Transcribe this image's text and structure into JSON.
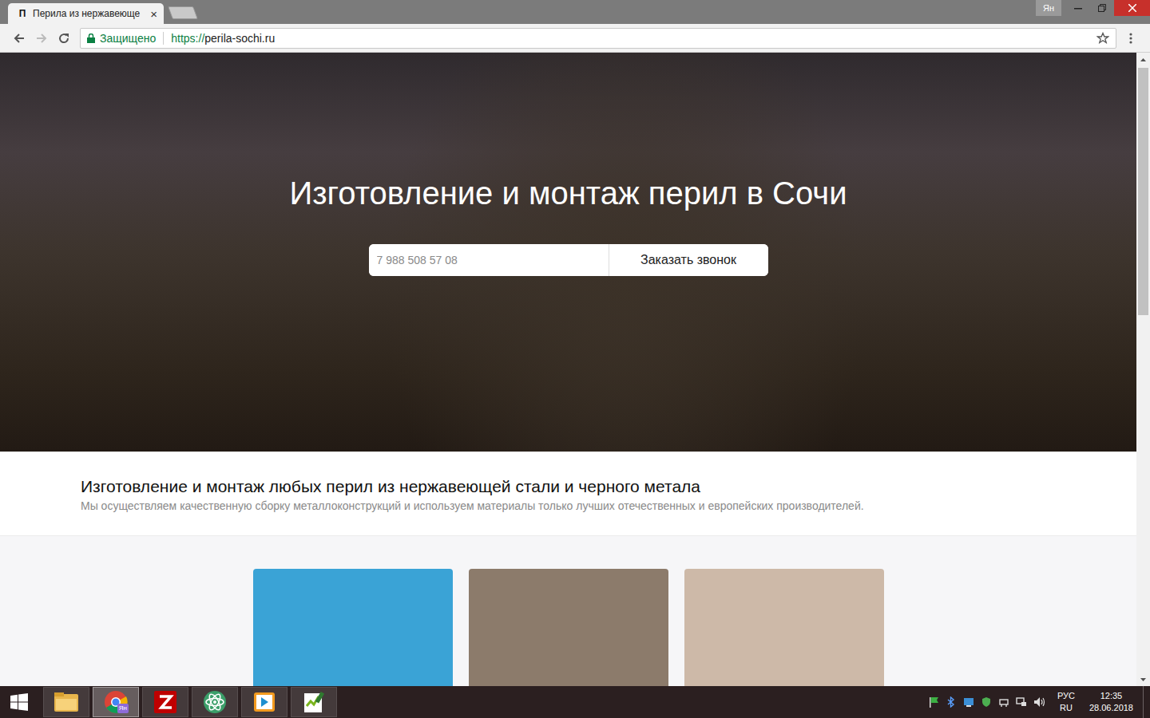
{
  "window": {
    "profile": "Ян"
  },
  "tabs": [
    {
      "label": "Перила из нержавеюще",
      "favicon": "П",
      "close": "×",
      "selected": true
    },
    {
      "selected": false
    }
  ],
  "address_bar": {
    "security": "Защищено",
    "scheme": "https://",
    "host": "perila-sochi.ru"
  },
  "hero": {
    "title": "Изготовление и монтаж перил в Сочи",
    "phone_placeholder": "7 988 508 57 08",
    "button": "Заказать звонок"
  },
  "intro": {
    "heading": "Изготовление и монтаж любых перил из нержавеющей стали и черного метала",
    "text": "Мы осуществляем качественную сборку металлоконструкций и используем материалы только лучших отечественных и европейских производителей."
  },
  "cards": [
    {
      "color": "#3aa3d6"
    },
    {
      "color": "#8c7b6b"
    },
    {
      "color": "#cdb9a8"
    }
  ],
  "taskbar": {
    "apps": [
      {
        "kind": "explorer",
        "selected": false
      },
      {
        "kind": "chrome",
        "selected": true,
        "badge": "Ян"
      },
      {
        "kind": "filezilla",
        "selected": false
      },
      {
        "kind": "atom",
        "selected": false
      },
      {
        "kind": "player",
        "selected": false
      },
      {
        "kind": "notepad",
        "selected": false
      }
    ],
    "tray": {
      "language": "РУС",
      "layout": "RU",
      "time": "12:35",
      "date": "28.06.2018"
    }
  }
}
